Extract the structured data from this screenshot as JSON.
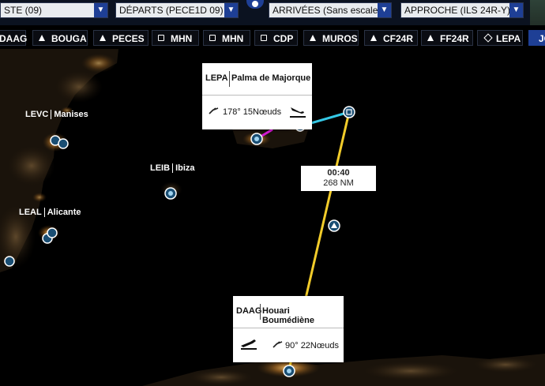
{
  "dropdowns": [
    {
      "value": "STE (09)"
    },
    {
      "value": "DÉPARTS (PECE1D 09)"
    },
    {
      "value": "ARRIVÉES (Sans escale)"
    },
    {
      "value": "APPROCHE (ILS 24R-Y)"
    }
  ],
  "waypoints": [
    {
      "label": "DAAG",
      "icon": "diamond-icon"
    },
    {
      "label": "BOUGA",
      "icon": "triangle-icon"
    },
    {
      "label": "PECES",
      "icon": "triangle-icon"
    },
    {
      "label": "MHN",
      "icon": "square-icon"
    },
    {
      "label": "MHN",
      "icon": "square-icon"
    },
    {
      "label": "CDP",
      "icon": "square-icon"
    },
    {
      "label": "MUROS",
      "icon": "triangle-icon"
    },
    {
      "label": "CF24R",
      "icon": "triangle-icon"
    },
    {
      "label": "FF24R",
      "icon": "triangle-icon"
    },
    {
      "label": "LEPA",
      "icon": "diamond-icon"
    },
    {
      "label": "JC"
    }
  ],
  "airports": {
    "levc": {
      "code": "LEVC",
      "name": "Manises"
    },
    "leib": {
      "code": "LEIB",
      "name": "Ibiza"
    },
    "leal": {
      "code": "LEAL",
      "name": "Alicante"
    }
  },
  "lepa_card": {
    "code": "LEPA",
    "name": "Palma de Majorque",
    "wind": "178° 15Nœuds",
    "icon": "landing-icon"
  },
  "daag_card": {
    "code": "DAAG",
    "name": "Houari Boumédiène",
    "wind": "90° 22Nœuds",
    "icon": "takeoff-icon"
  },
  "leg": {
    "time": "00:40",
    "distance": "268 NM"
  },
  "colors": {
    "route_yellow": "#f2cc2a",
    "route_cyan": "#35c8e6",
    "route_magenta": "#d21ad2",
    "accent_blue": "#1e3f95",
    "lights": "#f0a040"
  }
}
